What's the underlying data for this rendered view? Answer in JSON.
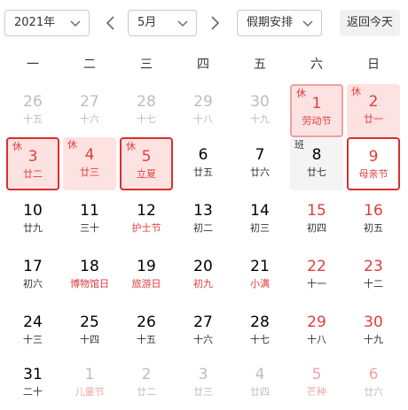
{
  "toolbar": {
    "year": "2021年",
    "month": "5月",
    "holiday": "假期安排",
    "today": "返回今天"
  },
  "weekdays": [
    "一",
    "二",
    "三",
    "四",
    "五",
    "六",
    "日"
  ],
  "badges": {
    "rest": "休",
    "work": "班"
  },
  "colors": {
    "accent_red": "#e23c3c",
    "rest_bg": "#fde2e2",
    "highlight_border": "#d9302c"
  },
  "icons": {
    "prev": "chevron-left-icon",
    "next": "chevron-right-icon",
    "dropdown": "chevron-down-icon"
  },
  "weeks": [
    [
      {
        "day": "26",
        "lunar": "十五",
        "other": true
      },
      {
        "day": "27",
        "lunar": "十六",
        "other": true
      },
      {
        "day": "28",
        "lunar": "十七",
        "other": true
      },
      {
        "day": "29",
        "lunar": "十八",
        "other": true
      },
      {
        "day": "30",
        "lunar": "十九",
        "other": true
      },
      {
        "day": "1",
        "lunar": "劳动节",
        "status": "rest",
        "outline": true,
        "weekend": true,
        "festival": true
      },
      {
        "day": "2",
        "lunar": "廿一",
        "status": "rest",
        "weekend": true
      }
    ],
    [
      {
        "day": "3",
        "lunar": "廿二",
        "status": "rest",
        "highlight": true
      },
      {
        "day": "4",
        "lunar": "廿三",
        "status": "rest"
      },
      {
        "day": "5",
        "lunar": "立夏",
        "status": "rest",
        "highlight": true,
        "festival": true
      },
      {
        "day": "6",
        "lunar": "廿五"
      },
      {
        "day": "7",
        "lunar": "廿六"
      },
      {
        "day": "8",
        "lunar": "廿七",
        "status": "work"
      },
      {
        "day": "9",
        "lunar": "母亲节",
        "highlight": true,
        "weekend": true,
        "festival": true
      }
    ],
    [
      {
        "day": "10",
        "lunar": "廿九"
      },
      {
        "day": "11",
        "lunar": "三十"
      },
      {
        "day": "12",
        "lunar": "护士节",
        "festival": true
      },
      {
        "day": "13",
        "lunar": "初二"
      },
      {
        "day": "14",
        "lunar": "初三"
      },
      {
        "day": "15",
        "lunar": "初四",
        "weekend": true
      },
      {
        "day": "16",
        "lunar": "初五",
        "weekend": true
      }
    ],
    [
      {
        "day": "17",
        "lunar": "初六"
      },
      {
        "day": "18",
        "lunar": "博物馆日",
        "festival": true
      },
      {
        "day": "19",
        "lunar": "旅游日",
        "festival": true
      },
      {
        "day": "20",
        "lunar": "初九",
        "festival": true
      },
      {
        "day": "21",
        "lunar": "小满",
        "festival": true
      },
      {
        "day": "22",
        "lunar": "十一",
        "weekend": true
      },
      {
        "day": "23",
        "lunar": "十二",
        "weekend": true
      }
    ],
    [
      {
        "day": "24",
        "lunar": "十三"
      },
      {
        "day": "25",
        "lunar": "十四"
      },
      {
        "day": "26",
        "lunar": "十五"
      },
      {
        "day": "27",
        "lunar": "十六"
      },
      {
        "day": "28",
        "lunar": "十七"
      },
      {
        "day": "29",
        "lunar": "十八",
        "weekend": true
      },
      {
        "day": "30",
        "lunar": "十九",
        "weekend": true
      }
    ],
    [
      {
        "day": "31",
        "lunar": "二十"
      },
      {
        "day": "1",
        "lunar": "儿童节",
        "other": true,
        "festival": true
      },
      {
        "day": "2",
        "lunar": "廿二",
        "other": true
      },
      {
        "day": "3",
        "lunar": "廿三",
        "other": true
      },
      {
        "day": "4",
        "lunar": "廿四",
        "other": true
      },
      {
        "day": "5",
        "lunar": "芒种",
        "other": true,
        "weekend": true,
        "festival": true
      },
      {
        "day": "6",
        "lunar": "廿六",
        "other": true,
        "weekend": true
      }
    ]
  ]
}
